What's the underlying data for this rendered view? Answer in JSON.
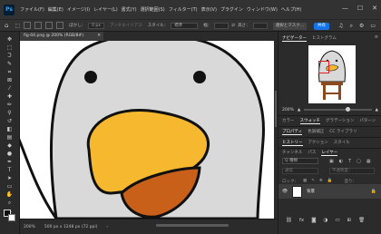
{
  "app": {
    "logo": "Ps"
  },
  "menu": [
    "ファイル(F)",
    "編集(E)",
    "イメージ(I)",
    "レイヤー(L)",
    "書式(Y)",
    "選択範囲(S)",
    "フィルター(T)",
    "表示(V)",
    "プラグイン",
    "ウィンドウ(W)",
    "ヘルプ(H)"
  ],
  "window_controls": {
    "minimize": "—",
    "maximize": "☐",
    "close": "✕"
  },
  "options": {
    "feather_label": "ぼかし：",
    "feather_value": "0 px",
    "antialias": "アンチエイリアス",
    "style_label": "スタイル：",
    "style_value": "標準",
    "width_label": "幅：",
    "height_label": "高さ：",
    "select_mask": "選択とマスク...",
    "share": "共有"
  },
  "document": {
    "tab_title": "fig-04.png @ 200% (RGB/8#)",
    "close": "✕"
  },
  "status": {
    "zoom": "200%",
    "dims": "500 px x 1248 px (72 ppi)",
    "arrow": "›"
  },
  "panels": {
    "nav_tabs": [
      "ナビゲーター",
      "ヒストグラム"
    ],
    "zoom_value": "200%",
    "mid_tabs_1": [
      "カラー",
      "スウォッチ",
      "グラデーション",
      "パターン"
    ],
    "mid_tabs_2": [
      "プロパティ",
      "色調補正",
      "CC ライブラリ"
    ],
    "mid_tabs_3": [
      "ヒストリー",
      "アクション",
      "スタイル"
    ],
    "layer_tabs": [
      "チャンネル",
      "パス",
      "レイヤー"
    ],
    "layer_search": "Q 種類",
    "blend_mode": "通常",
    "opacity": "不透明度：",
    "lock_label": "ロック：",
    "fill": "塗り：",
    "layer_name": "背景",
    "menu_glyph": "≡"
  },
  "colors": {
    "accent": "#1473e6",
    "beak": "#f5b82e",
    "mouth": "#c8601a",
    "body": "#d9d9d9",
    "outline": "#111111"
  }
}
